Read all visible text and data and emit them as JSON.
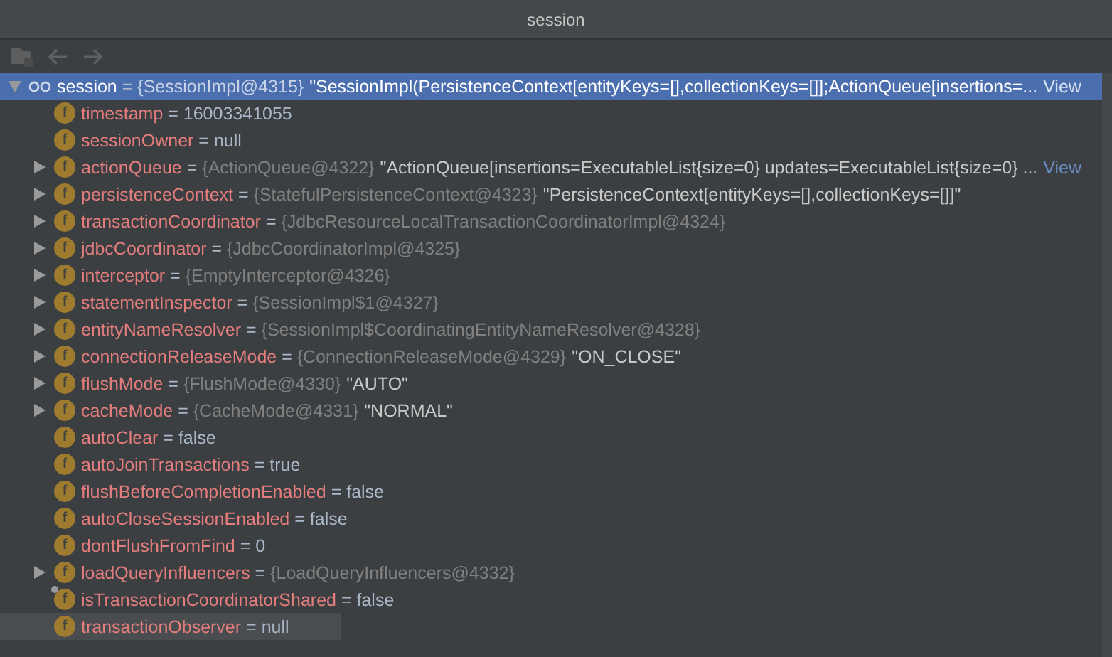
{
  "window": {
    "title": "session"
  },
  "separator": "=",
  "tree": [
    {
      "name": "session",
      "type": "{SessionImpl@4315}",
      "value": "\"SessionImpl(PersistenceContext[entityKeys=[],collectionKeys=[]];ActionQueue[insertions=...",
      "link": "View",
      "expanded": true,
      "selected": true,
      "kind": "variable",
      "children": [
        {
          "kind": "field",
          "icon": "f",
          "name": "timestamp",
          "value": "16003341055",
          "expandable": false
        },
        {
          "kind": "field",
          "icon": "f",
          "name": "sessionOwner",
          "value": "null",
          "expandable": false
        },
        {
          "kind": "field",
          "icon": "f",
          "name": "actionQueue",
          "type": "{ActionQueue@4322}",
          "value": "\"ActionQueue[insertions=ExecutableList{size=0} updates=ExecutableList{size=0} ...",
          "link": "View",
          "expandable": true
        },
        {
          "kind": "field",
          "icon": "f",
          "name": "persistenceContext",
          "type": "{StatefulPersistenceContext@4323}",
          "value": "\"PersistenceContext[entityKeys=[],collectionKeys=[]]\"",
          "expandable": true
        },
        {
          "kind": "field",
          "icon": "f",
          "name": "transactionCoordinator",
          "type": "{JdbcResourceLocalTransactionCoordinatorImpl@4324}",
          "expandable": true
        },
        {
          "kind": "field",
          "icon": "f",
          "name": "jdbcCoordinator",
          "type": "{JdbcCoordinatorImpl@4325}",
          "expandable": true
        },
        {
          "kind": "field",
          "icon": "f",
          "name": "interceptor",
          "type": "{EmptyInterceptor@4326}",
          "expandable": true
        },
        {
          "kind": "field",
          "icon": "f",
          "name": "statementInspector",
          "type": "{SessionImpl$1@4327}",
          "expandable": true
        },
        {
          "kind": "field",
          "icon": "f",
          "name": "entityNameResolver",
          "type": "{SessionImpl$CoordinatingEntityNameResolver@4328}",
          "expandable": true
        },
        {
          "kind": "field",
          "icon": "f",
          "name": "connectionReleaseMode",
          "type": "{ConnectionReleaseMode@4329}",
          "value": "\"ON_CLOSE\"",
          "expandable": true
        },
        {
          "kind": "field",
          "icon": "f",
          "name": "flushMode",
          "type": "{FlushMode@4330}",
          "value": "\"AUTO\"",
          "expandable": true
        },
        {
          "kind": "field",
          "icon": "f",
          "name": "cacheMode",
          "type": "{CacheMode@4331}",
          "value": "\"NORMAL\"",
          "expandable": true
        },
        {
          "kind": "field",
          "icon": "f",
          "name": "autoClear",
          "value": "false",
          "expandable": false
        },
        {
          "kind": "field",
          "icon": "f",
          "name": "autoJoinTransactions",
          "value": "true",
          "expandable": false
        },
        {
          "kind": "field",
          "icon": "f",
          "name": "flushBeforeCompletionEnabled",
          "value": "false",
          "expandable": false
        },
        {
          "kind": "field",
          "icon": "f",
          "name": "autoCloseSessionEnabled",
          "value": "false",
          "expandable": false
        },
        {
          "kind": "field",
          "icon": "f",
          "name": "dontFlushFromFind",
          "value": "0",
          "expandable": false
        },
        {
          "kind": "field",
          "icon": "f",
          "name": "loadQueryInfluencers",
          "type": "{LoadQueryInfluencers@4332}",
          "expandable": true
        },
        {
          "kind": "field",
          "icon": "f",
          "name": "isTransactionCoordinatorShared",
          "value": "false",
          "expandable": false,
          "transient": true
        },
        {
          "kind": "field",
          "icon": "f",
          "name": "transactionObserver",
          "value": "null",
          "expandable": false,
          "hovered": true
        }
      ]
    }
  ]
}
